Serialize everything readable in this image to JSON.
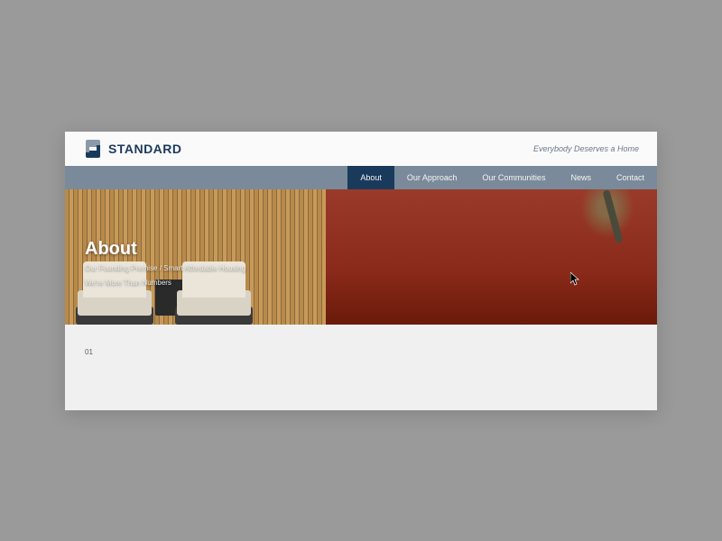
{
  "header": {
    "brand": "STANDARD",
    "tagline": "Everybody Deserves a Home"
  },
  "nav": {
    "items": [
      {
        "label": "About",
        "active": true
      },
      {
        "label": "Our Approach",
        "active": false
      },
      {
        "label": "Our Communities",
        "active": false
      },
      {
        "label": "News",
        "active": false
      },
      {
        "label": "Contact",
        "active": false
      }
    ]
  },
  "hero": {
    "title": "About",
    "subline1": "Our Founding Premise / Smart Affordable Housing",
    "subline2": "We're More Than Numbers"
  },
  "content": {
    "page_number": "01"
  },
  "colors": {
    "brand_primary": "#1a3a5c",
    "nav_bg": "#7a8a9a",
    "hero_accent": "#9a3a2a"
  }
}
